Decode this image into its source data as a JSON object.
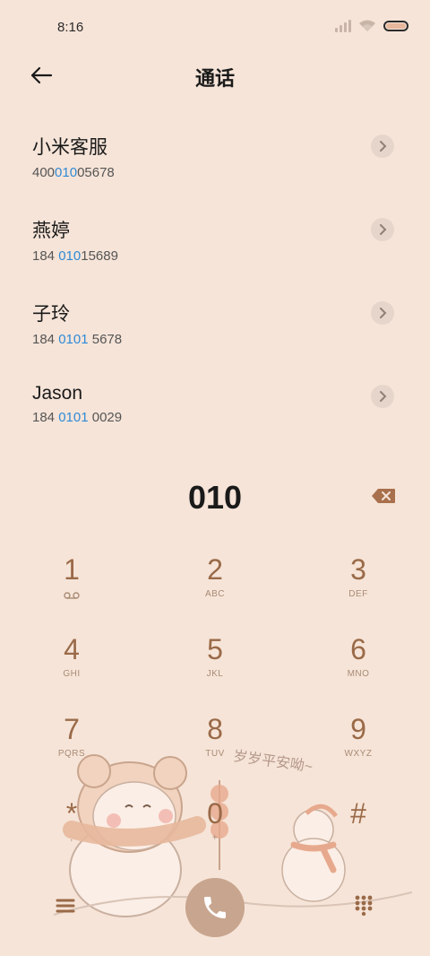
{
  "status": {
    "time": "8:16"
  },
  "header": {
    "title": "通话"
  },
  "contacts": [
    {
      "name": "小米客服",
      "number_pre": "400",
      "number_hl": "010",
      "number_post": "05678"
    },
    {
      "name": "燕婷",
      "number_pre": "184 ",
      "number_hl": "010",
      "number_post": "15689"
    },
    {
      "name": "子玲",
      "number_pre": "184 ",
      "number_hl": "0101",
      "number_post": " 5678"
    },
    {
      "name": "Jason",
      "number_pre": "184 ",
      "number_hl": "0101",
      "number_post": " 0029"
    }
  ],
  "dialer": {
    "digits": "010"
  },
  "keys": [
    {
      "num": "1",
      "sub": ""
    },
    {
      "num": "2",
      "sub": "ABC"
    },
    {
      "num": "3",
      "sub": "DEF"
    },
    {
      "num": "4",
      "sub": "GHI"
    },
    {
      "num": "5",
      "sub": "JKL"
    },
    {
      "num": "6",
      "sub": "MNO"
    },
    {
      "num": "7",
      "sub": "PQRS"
    },
    {
      "num": "8",
      "sub": "TUV"
    },
    {
      "num": "9",
      "sub": "WXYZ"
    },
    {
      "num": "*",
      "sub": ","
    },
    {
      "num": "0",
      "sub": "+"
    },
    {
      "num": "#",
      "sub": ""
    }
  ],
  "illustration": {
    "text": "岁岁平安呦~"
  },
  "colors": {
    "background": "#f6e4d8",
    "accent": "#9a6a48",
    "highlight": "#2f8ad6",
    "call_button": "#c8a58e"
  }
}
